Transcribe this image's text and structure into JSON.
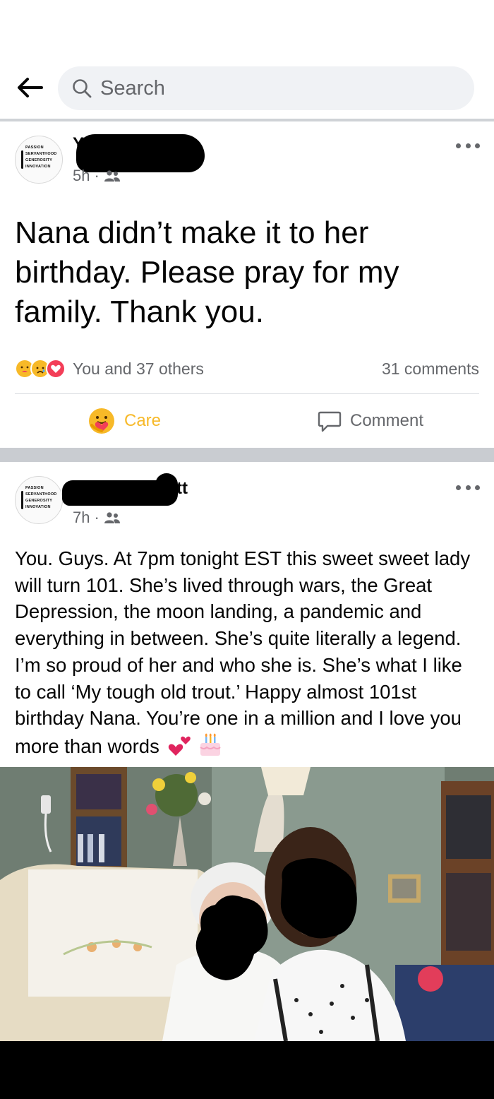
{
  "search": {
    "placeholder": "Search"
  },
  "posts": [
    {
      "author_visible_fragment": "Y",
      "time": "5h",
      "audience": "friends",
      "text": "Nana didn’t make it to her birthday. Please pray for my family. Thank you.",
      "reactions_text": "You and 37 others",
      "comments_text": "31 comments",
      "actions": {
        "care": "Care",
        "comment": "Comment"
      }
    },
    {
      "author_visible_fragment": "tt",
      "time": "7h",
      "audience": "friends",
      "text": "You. Guys. At 7pm tonight EST this sweet sweet lady will turn 101. She’s lived through wars, the Great Depression, the moon landing, a pandemic and everything in between. She’s quite literally a legend. I’m so proud of her and who she is. She’s what I like to call ‘My tough old trout.’ Happy almost 101st birthday Nana. You’re one in a million and I love you more than words"
    }
  ],
  "avatar_logo_lines": [
    "PASSION",
    "SERVANTHOOD",
    "GENEROSITY",
    "INNOVATION"
  ],
  "colors": {
    "care": "#f7b928",
    "muted_text": "#65676b",
    "search_bg": "#f0f2f5",
    "love_reaction": "#f33e58",
    "feed_gap": "#c9ccd1"
  }
}
